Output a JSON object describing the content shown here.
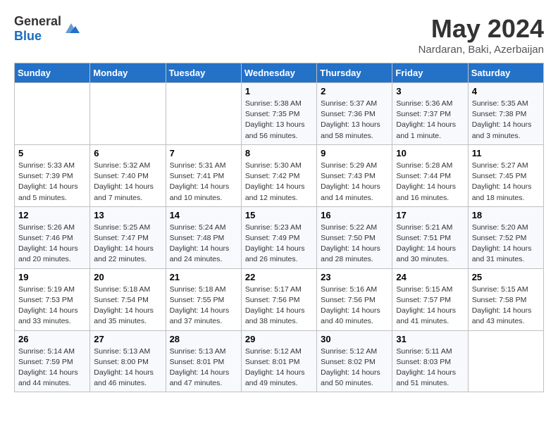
{
  "logo": {
    "general": "General",
    "blue": "Blue"
  },
  "header": {
    "month": "May 2024",
    "location": "Nardaran, Baki, Azerbaijan"
  },
  "days_of_week": [
    "Sunday",
    "Monday",
    "Tuesday",
    "Wednesday",
    "Thursday",
    "Friday",
    "Saturday"
  ],
  "weeks": [
    [
      {
        "day": "",
        "info": ""
      },
      {
        "day": "",
        "info": ""
      },
      {
        "day": "",
        "info": ""
      },
      {
        "day": "1",
        "info": "Sunrise: 5:38 AM\nSunset: 7:35 PM\nDaylight: 13 hours\nand 56 minutes."
      },
      {
        "day": "2",
        "info": "Sunrise: 5:37 AM\nSunset: 7:36 PM\nDaylight: 13 hours\nand 58 minutes."
      },
      {
        "day": "3",
        "info": "Sunrise: 5:36 AM\nSunset: 7:37 PM\nDaylight: 14 hours\nand 1 minute."
      },
      {
        "day": "4",
        "info": "Sunrise: 5:35 AM\nSunset: 7:38 PM\nDaylight: 14 hours\nand 3 minutes."
      }
    ],
    [
      {
        "day": "5",
        "info": "Sunrise: 5:33 AM\nSunset: 7:39 PM\nDaylight: 14 hours\nand 5 minutes."
      },
      {
        "day": "6",
        "info": "Sunrise: 5:32 AM\nSunset: 7:40 PM\nDaylight: 14 hours\nand 7 minutes."
      },
      {
        "day": "7",
        "info": "Sunrise: 5:31 AM\nSunset: 7:41 PM\nDaylight: 14 hours\nand 10 minutes."
      },
      {
        "day": "8",
        "info": "Sunrise: 5:30 AM\nSunset: 7:42 PM\nDaylight: 14 hours\nand 12 minutes."
      },
      {
        "day": "9",
        "info": "Sunrise: 5:29 AM\nSunset: 7:43 PM\nDaylight: 14 hours\nand 14 minutes."
      },
      {
        "day": "10",
        "info": "Sunrise: 5:28 AM\nSunset: 7:44 PM\nDaylight: 14 hours\nand 16 minutes."
      },
      {
        "day": "11",
        "info": "Sunrise: 5:27 AM\nSunset: 7:45 PM\nDaylight: 14 hours\nand 18 minutes."
      }
    ],
    [
      {
        "day": "12",
        "info": "Sunrise: 5:26 AM\nSunset: 7:46 PM\nDaylight: 14 hours\nand 20 minutes."
      },
      {
        "day": "13",
        "info": "Sunrise: 5:25 AM\nSunset: 7:47 PM\nDaylight: 14 hours\nand 22 minutes."
      },
      {
        "day": "14",
        "info": "Sunrise: 5:24 AM\nSunset: 7:48 PM\nDaylight: 14 hours\nand 24 minutes."
      },
      {
        "day": "15",
        "info": "Sunrise: 5:23 AM\nSunset: 7:49 PM\nDaylight: 14 hours\nand 26 minutes."
      },
      {
        "day": "16",
        "info": "Sunrise: 5:22 AM\nSunset: 7:50 PM\nDaylight: 14 hours\nand 28 minutes."
      },
      {
        "day": "17",
        "info": "Sunrise: 5:21 AM\nSunset: 7:51 PM\nDaylight: 14 hours\nand 30 minutes."
      },
      {
        "day": "18",
        "info": "Sunrise: 5:20 AM\nSunset: 7:52 PM\nDaylight: 14 hours\nand 31 minutes."
      }
    ],
    [
      {
        "day": "19",
        "info": "Sunrise: 5:19 AM\nSunset: 7:53 PM\nDaylight: 14 hours\nand 33 minutes."
      },
      {
        "day": "20",
        "info": "Sunrise: 5:18 AM\nSunset: 7:54 PM\nDaylight: 14 hours\nand 35 minutes."
      },
      {
        "day": "21",
        "info": "Sunrise: 5:18 AM\nSunset: 7:55 PM\nDaylight: 14 hours\nand 37 minutes."
      },
      {
        "day": "22",
        "info": "Sunrise: 5:17 AM\nSunset: 7:56 PM\nDaylight: 14 hours\nand 38 minutes."
      },
      {
        "day": "23",
        "info": "Sunrise: 5:16 AM\nSunset: 7:56 PM\nDaylight: 14 hours\nand 40 minutes."
      },
      {
        "day": "24",
        "info": "Sunrise: 5:15 AM\nSunset: 7:57 PM\nDaylight: 14 hours\nand 41 minutes."
      },
      {
        "day": "25",
        "info": "Sunrise: 5:15 AM\nSunset: 7:58 PM\nDaylight: 14 hours\nand 43 minutes."
      }
    ],
    [
      {
        "day": "26",
        "info": "Sunrise: 5:14 AM\nSunset: 7:59 PM\nDaylight: 14 hours\nand 44 minutes."
      },
      {
        "day": "27",
        "info": "Sunrise: 5:13 AM\nSunset: 8:00 PM\nDaylight: 14 hours\nand 46 minutes."
      },
      {
        "day": "28",
        "info": "Sunrise: 5:13 AM\nSunset: 8:01 PM\nDaylight: 14 hours\nand 47 minutes."
      },
      {
        "day": "29",
        "info": "Sunrise: 5:12 AM\nSunset: 8:01 PM\nDaylight: 14 hours\nand 49 minutes."
      },
      {
        "day": "30",
        "info": "Sunrise: 5:12 AM\nSunset: 8:02 PM\nDaylight: 14 hours\nand 50 minutes."
      },
      {
        "day": "31",
        "info": "Sunrise: 5:11 AM\nSunset: 8:03 PM\nDaylight: 14 hours\nand 51 minutes."
      },
      {
        "day": "",
        "info": ""
      }
    ]
  ]
}
